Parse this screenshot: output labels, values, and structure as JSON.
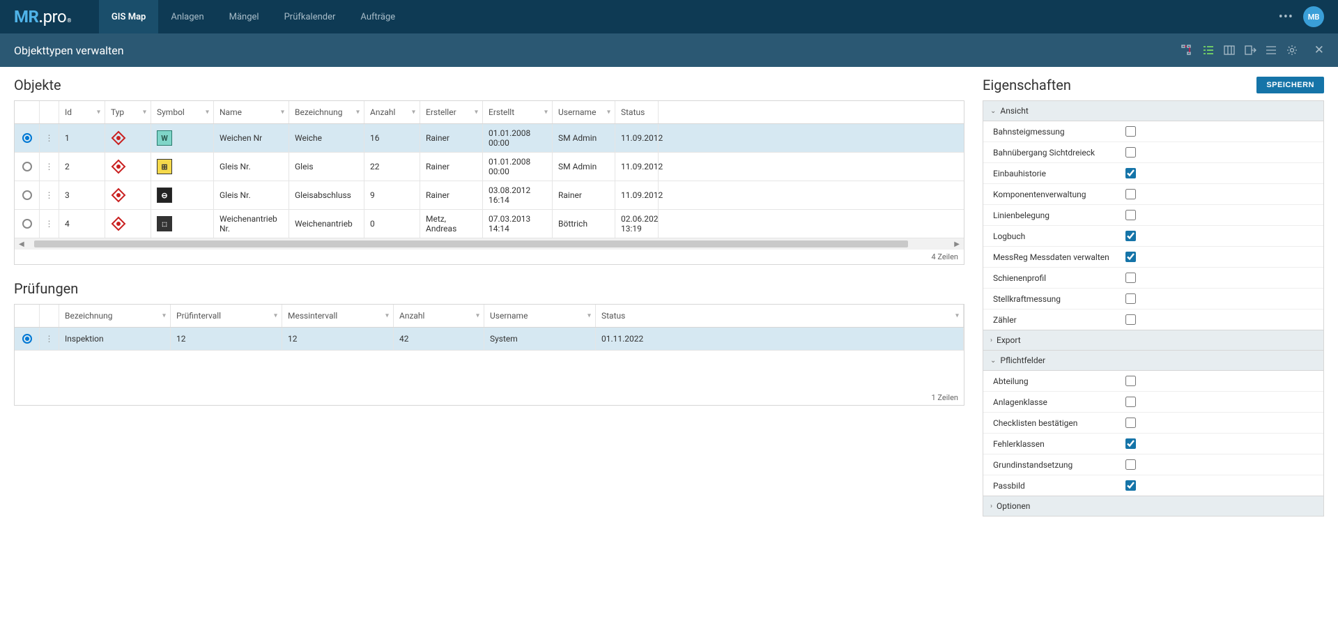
{
  "top": {
    "logo_mr": "MR",
    "logo_dot": ".",
    "logo_pro": "pro",
    "logo_reg": "®",
    "tabs": [
      "GIS Map",
      "Anlagen",
      "Mängel",
      "Prüfkalender",
      "Aufträge"
    ],
    "active_tab": 0,
    "dots": "•••",
    "avatar": "MB"
  },
  "sub": {
    "title": "Objekttypen verwalten"
  },
  "objekte": {
    "title": "Objekte",
    "headers": [
      "Id",
      "Typ",
      "Symbol",
      "Name",
      "Bezeichnung",
      "Anzahl",
      "Ersteller",
      "Erstellt",
      "Username",
      "Status"
    ],
    "rows": [
      {
        "id": "1",
        "name": "Weichen Nr",
        "bez": "Weiche",
        "anz": "16",
        "ersteller": "Rainer",
        "erstellt": "01.01.2008 00:00",
        "user": "SM Admin",
        "status": "11.09.2012",
        "selected": true,
        "symbol_class": "teal",
        "symbol_txt": "W"
      },
      {
        "id": "2",
        "name": "Gleis Nr.",
        "bez": "Gleis",
        "anz": "22",
        "ersteller": "Rainer",
        "erstellt": "01.01.2008 00:00",
        "user": "SM Admin",
        "status": "11.09.2012",
        "selected": false,
        "symbol_class": "yellow",
        "symbol_txt": "⊞"
      },
      {
        "id": "3",
        "name": "Gleis Nr.",
        "bez": "Gleisabschluss",
        "anz": "9",
        "ersteller": "Rainer",
        "erstellt": "03.08.2012 16:14",
        "user": "Rainer",
        "status": "11.09.2012",
        "selected": false,
        "symbol_class": "black",
        "symbol_txt": "⊖"
      },
      {
        "id": "4",
        "name": "Weichenantrieb Nr.",
        "bez": "Weichenantrieb",
        "anz": "0",
        "ersteller": "Metz, Andreas",
        "erstellt": "07.03.2013 14:14",
        "user": "Böttrich",
        "status": "02.06.202 13:19",
        "selected": false,
        "symbol_class": "dark",
        "symbol_txt": "⬚"
      }
    ],
    "footer": "4 Zeilen"
  },
  "pruef": {
    "title": "Prüfungen",
    "headers": [
      "Bezeichnung",
      "Prüfintervall",
      "Messintervall",
      "Anzahl",
      "Username",
      "Status"
    ],
    "rows": [
      {
        "bez": "Inspektion",
        "pint": "12",
        "mint": "12",
        "anz": "42",
        "user": "System",
        "status": "01.11.2022",
        "selected": true
      }
    ],
    "footer": "1 Zeilen"
  },
  "props": {
    "title": "Eigenschaften",
    "save": "SPEICHERN",
    "ansicht": {
      "label": "Ansicht",
      "items": [
        {
          "label": "Bahnsteigmessung",
          "checked": false
        },
        {
          "label": "Bahnübergang Sichtdreieck",
          "checked": false
        },
        {
          "label": "Einbauhistorie",
          "checked": true
        },
        {
          "label": "Komponentenverwaltung",
          "checked": false
        },
        {
          "label": "Linienbelegung",
          "checked": false
        },
        {
          "label": "Logbuch",
          "checked": true
        },
        {
          "label": "MessReg Messdaten verwalten",
          "checked": true
        },
        {
          "label": "Schienenprofil",
          "checked": false
        },
        {
          "label": "Stellkraftmessung",
          "checked": false
        },
        {
          "label": "Zähler",
          "checked": false
        }
      ]
    },
    "export": {
      "label": "Export"
    },
    "pflicht": {
      "label": "Pflichtfelder",
      "items": [
        {
          "label": "Abteilung",
          "checked": false
        },
        {
          "label": "Anlagenklasse",
          "checked": false
        },
        {
          "label": "Checklisten bestätigen",
          "checked": false
        },
        {
          "label": "Fehlerklassen",
          "checked": true
        },
        {
          "label": "Grundinstandsetzung",
          "checked": false
        },
        {
          "label": "Passbild",
          "checked": true
        }
      ]
    },
    "optionen": {
      "label": "Optionen"
    }
  }
}
